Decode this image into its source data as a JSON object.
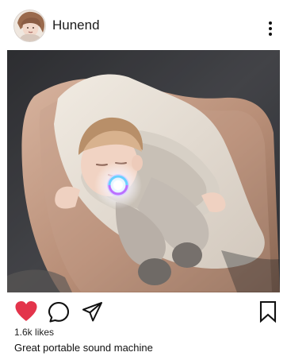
{
  "account": {
    "username": "Hunend"
  },
  "post": {
    "likes_count": "1.6k",
    "likes_label": "likes",
    "caption": "Great portable sound machine",
    "liked": true
  },
  "icons": {
    "avatar": "avatar-photo",
    "more": "three-dot-icon",
    "like": "heart-icon",
    "comment": "comment-icon",
    "share": "paper-plane-icon",
    "save": "bookmark-icon"
  },
  "colors": {
    "like_red": "#e3344b",
    "text": "#111111"
  }
}
